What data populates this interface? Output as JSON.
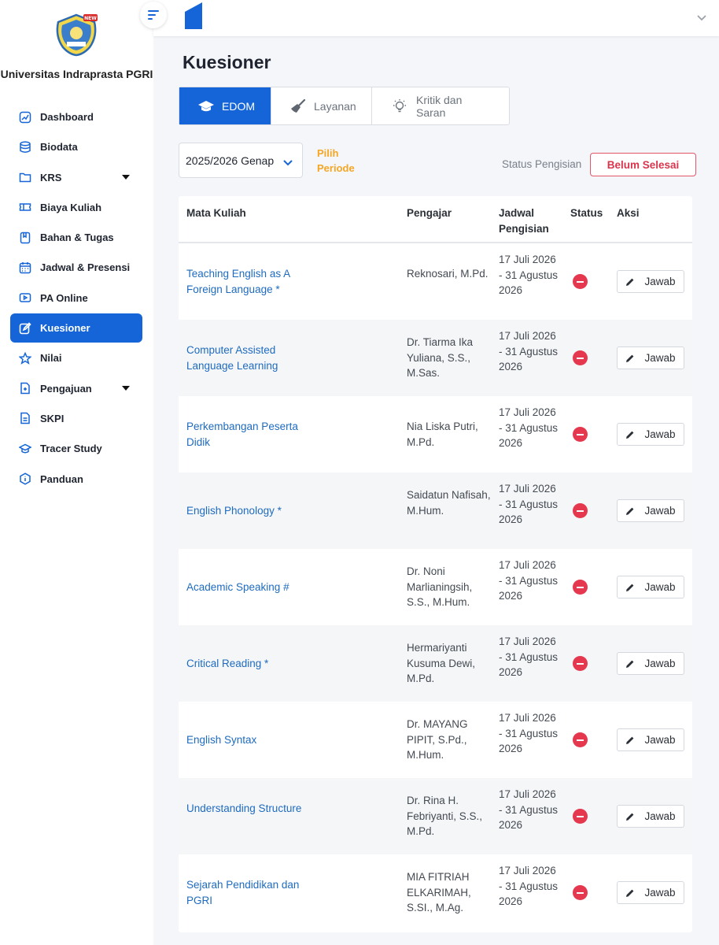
{
  "sidebar": {
    "university": "Universitas Indraprasta PGRI",
    "logo_badge": "NEW",
    "items": [
      {
        "label": "Dashboard",
        "icon": "chart-icon"
      },
      {
        "label": "Biodata",
        "icon": "database-icon"
      },
      {
        "label": "KRS",
        "icon": "folder-icon"
      },
      {
        "label": "Biaya Kuliah",
        "icon": "ticket-icon"
      },
      {
        "label": "Bahan & Tugas",
        "icon": "bookmark-icon"
      },
      {
        "label": "Jadwal & Presensi",
        "icon": "calendar-icon"
      },
      {
        "label": "PA Online",
        "icon": "video-icon"
      },
      {
        "label": "Kuesioner",
        "icon": "edit-icon"
      },
      {
        "label": "Nilai",
        "icon": "star-icon"
      },
      {
        "label": "Pengajuan",
        "icon": "file-icon"
      },
      {
        "label": "SKPI",
        "icon": "document-icon"
      },
      {
        "label": "Tracer Study",
        "icon": "graduation-icon"
      },
      {
        "label": "Panduan",
        "icon": "info-icon"
      }
    ]
  },
  "page": {
    "title": "Kuesioner"
  },
  "tabs": [
    {
      "label": "EDOM",
      "icon": "graduation-cap-icon"
    },
    {
      "label": "Layanan",
      "icon": "broom-icon"
    },
    {
      "label": "Kritik dan Saran",
      "icon": "lightbulb-icon"
    }
  ],
  "filters": {
    "period_value": "2025/2026 Genap",
    "period_hint": "Pilih Periode",
    "status_label": "Status Pengisian",
    "status_value": "Belum Selesai"
  },
  "table": {
    "headers": {
      "course": "Mata Kuliah",
      "lecturer": "Pengajar",
      "schedule": "Jadwal Pengisian",
      "status": "Status",
      "action": "Aksi"
    },
    "action_label": "Jawab",
    "rows": [
      {
        "course": "Teaching English as A Foreign Language *",
        "lecturer": "Reknosari, M.Pd.",
        "schedule": "17 Juli 2026 - 31 Agustus 2026"
      },
      {
        "course": "Computer Assisted Language Learning",
        "lecturer": "Dr. Tiarma Ika Yuliana, S.S., M.Sas.",
        "schedule": "17 Juli 2026 - 31 Agustus 2026"
      },
      {
        "course": "Perkembangan Peserta Didik",
        "lecturer": "Nia Liska Putri, M.Pd.",
        "schedule": "17 Juli 2026 - 31 Agustus 2026"
      },
      {
        "course": "English Phonology *",
        "lecturer": "Saidatun Nafisah, M.Hum.",
        "schedule": "17 Juli 2026 - 31 Agustus 2026"
      },
      {
        "course": "Academic Speaking #",
        "lecturer": "Dr. Noni Marlianingsih, S.S., M.Hum.",
        "schedule": "17 Juli 2026 - 31 Agustus 2026"
      },
      {
        "course": "Critical Reading *",
        "lecturer": "Hermariyanti Kusuma Dewi, M.Pd.",
        "schedule": "17 Juli 2026 - 31 Agustus 2026"
      },
      {
        "course": "English Syntax",
        "lecturer": "Dr. MAYANG PIPIT, S.Pd., M.Hum.",
        "schedule": "17 Juli 2026 - 31 Agustus 2026"
      },
      {
        "course": "Understanding Structure",
        "lecturer": "Dr. Rina H. Febriyanti, S.S., M.Pd.",
        "schedule": "17 Juli 2026 - 31 Agustus 2026"
      },
      {
        "course": "Sejarah Pendidikan dan PGRI",
        "lecturer": "MIA FITRIAH ELKARIMAH, S.SI., M.Ag.",
        "schedule": "17 Juli 2026 - 31 Agustus 2026"
      }
    ]
  },
  "colors": {
    "primary": "#1565d8",
    "danger": "#e5374d",
    "warning": "#f5a623",
    "link": "#1e6bbf"
  }
}
